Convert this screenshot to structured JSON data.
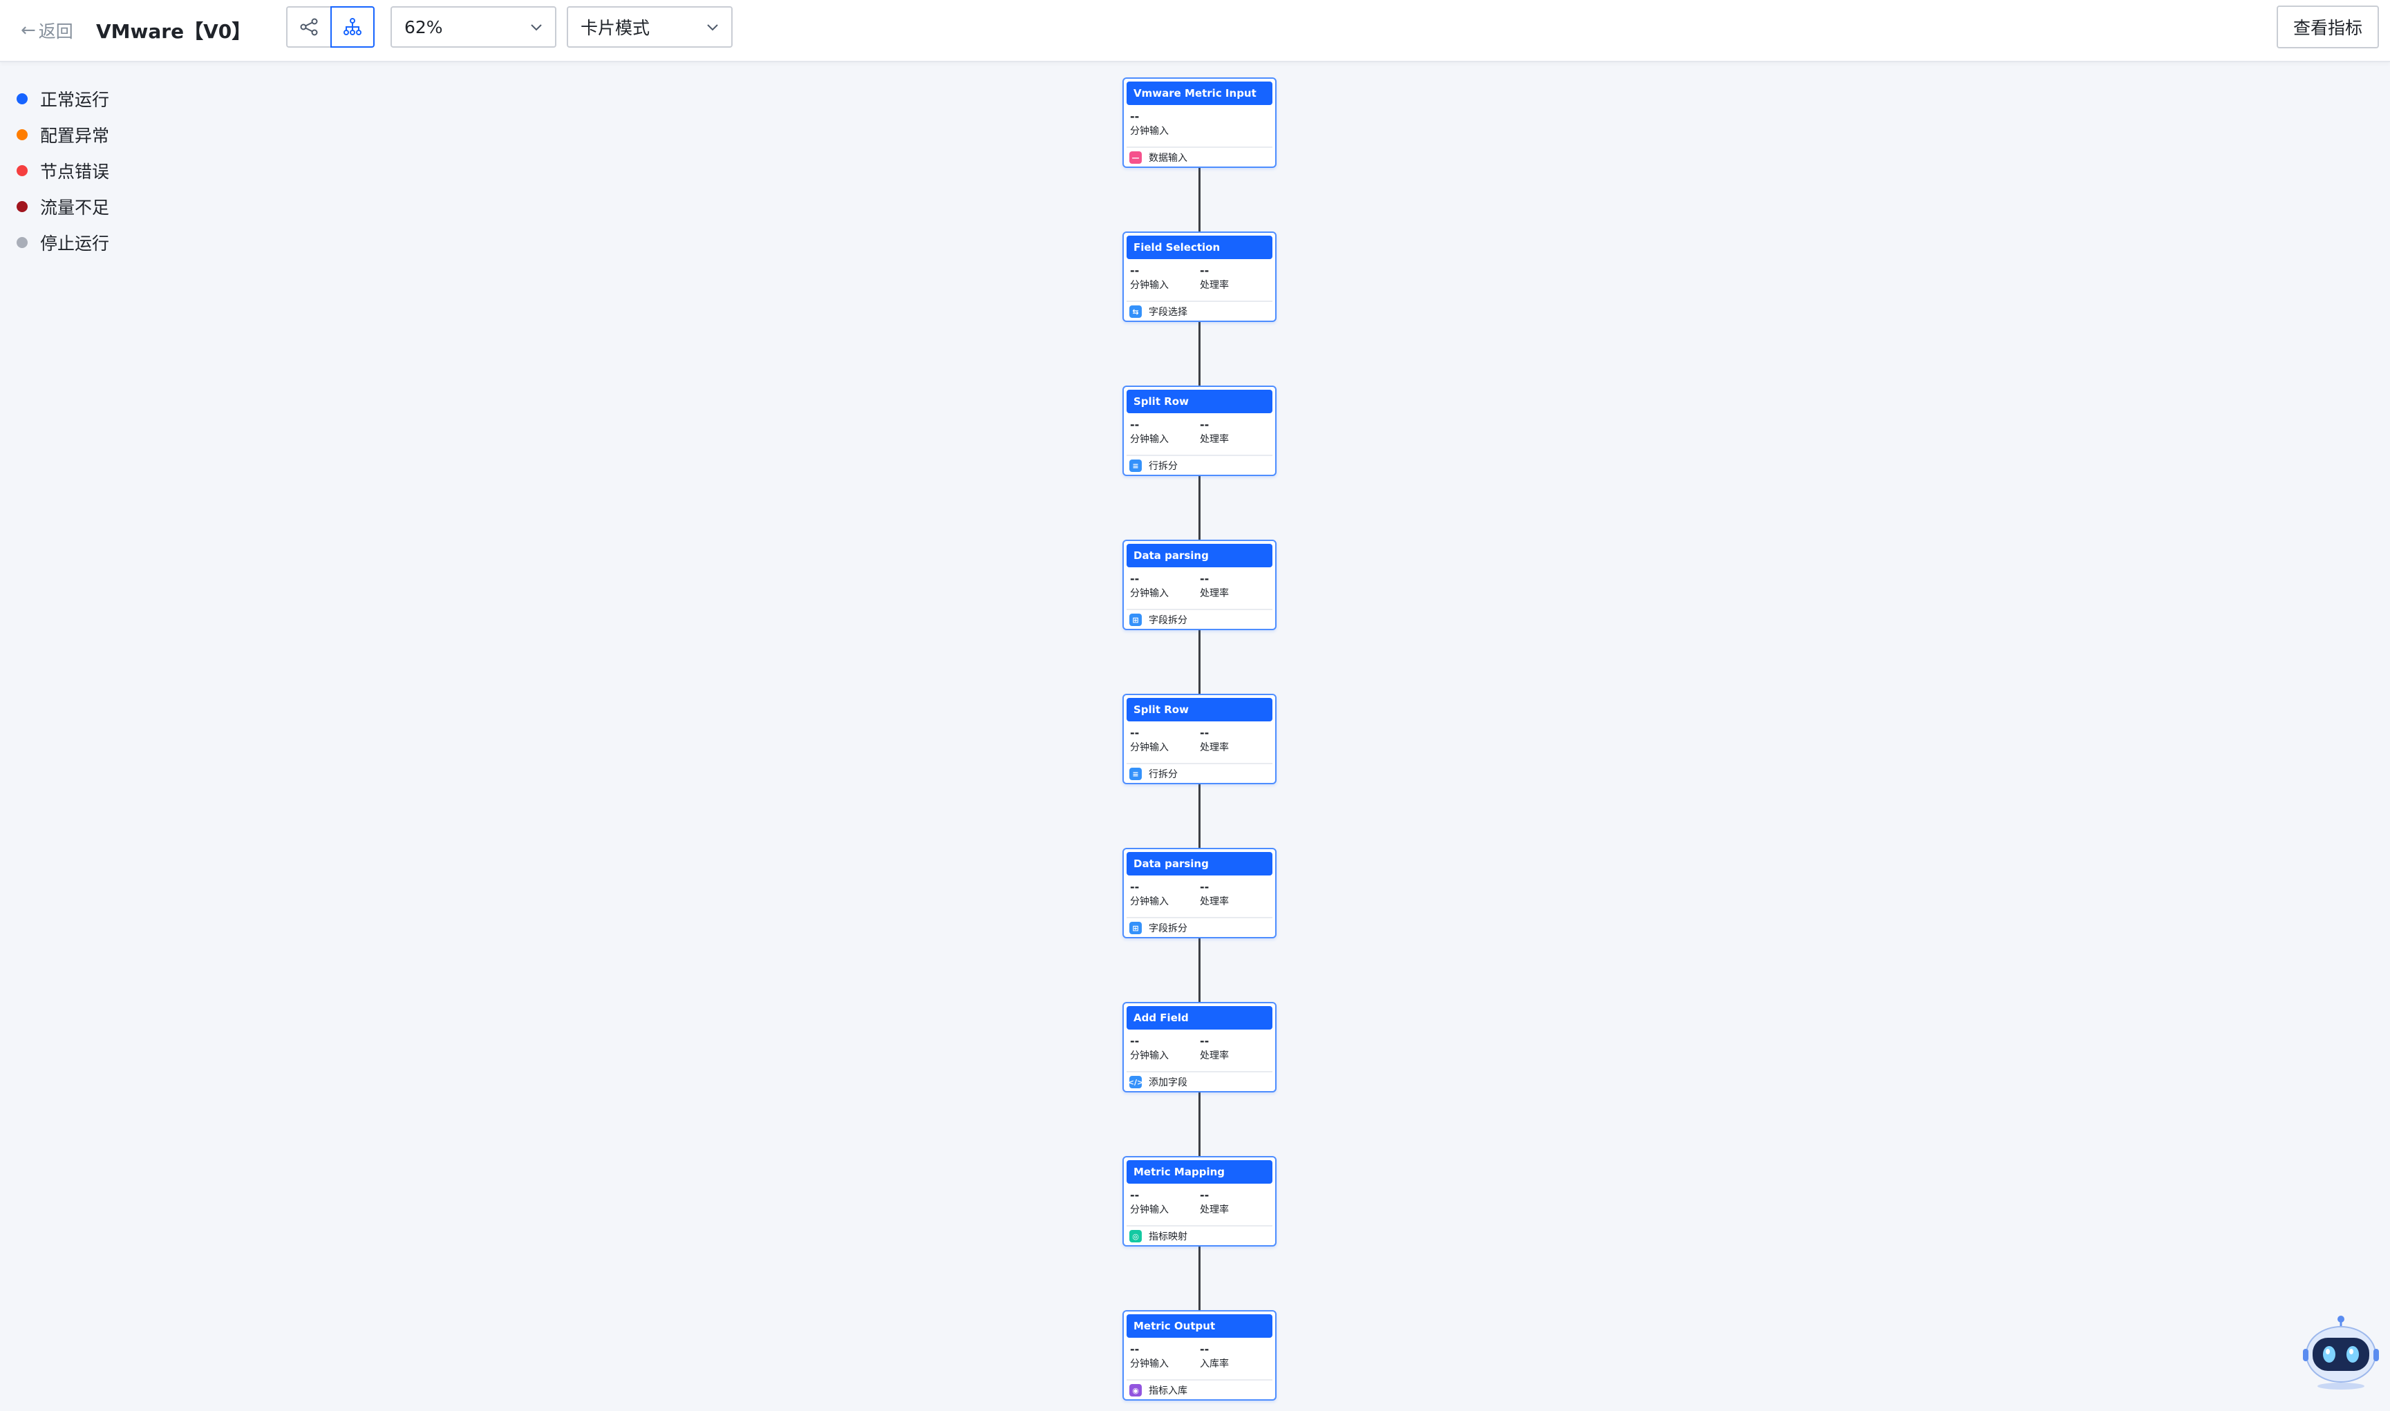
{
  "header": {
    "back_label": "返回",
    "title": "VMware【V0】",
    "zoom_value": "62%",
    "mode_value": "卡片模式",
    "metrics_button": "查看指标"
  },
  "legend": [
    {
      "label": "正常运行",
      "color": "#1664ff"
    },
    {
      "label": "配置异常",
      "color": "#ff7d00"
    },
    {
      "label": "节点错误",
      "color": "#f53f3f"
    },
    {
      "label": "流量不足",
      "color": "#a1151e"
    },
    {
      "label": "停止运行",
      "color": "#a9aeb8"
    }
  ],
  "pipeline": [
    {
      "title": "Vmware Metric Input",
      "stats": [
        {
          "value": "--",
          "label": "分钟输入"
        }
      ],
      "type_label": "数据输入",
      "icon": "data-input-icon",
      "icon_color": "#f5518c"
    },
    {
      "title": "Field Selection",
      "stats": [
        {
          "value": "--",
          "label": "分钟输入"
        },
        {
          "value": "--",
          "label": "处理率"
        }
      ],
      "type_label": "字段选择",
      "icon": "field-select-icon",
      "icon_color": "#3491fa"
    },
    {
      "title": "Split Row",
      "stats": [
        {
          "value": "--",
          "label": "分钟输入"
        },
        {
          "value": "--",
          "label": "处理率"
        }
      ],
      "type_label": "行拆分",
      "icon": "split-row-icon",
      "icon_color": "#3491fa"
    },
    {
      "title": "Data parsing",
      "stats": [
        {
          "value": "--",
          "label": "分钟输入"
        },
        {
          "value": "--",
          "label": "处理率"
        }
      ],
      "type_label": "字段拆分",
      "icon": "field-split-icon",
      "icon_color": "#3491fa"
    },
    {
      "title": "Split Row",
      "stats": [
        {
          "value": "--",
          "label": "分钟输入"
        },
        {
          "value": "--",
          "label": "处理率"
        }
      ],
      "type_label": "行拆分",
      "icon": "split-row-icon",
      "icon_color": "#3491fa"
    },
    {
      "title": "Data parsing",
      "stats": [
        {
          "value": "--",
          "label": "分钟输入"
        },
        {
          "value": "--",
          "label": "处理率"
        }
      ],
      "type_label": "字段拆分",
      "icon": "field-split-icon",
      "icon_color": "#3491fa"
    },
    {
      "title": "Add Field",
      "stats": [
        {
          "value": "--",
          "label": "分钟输入"
        },
        {
          "value": "--",
          "label": "处理率"
        }
      ],
      "type_label": "添加字段",
      "icon": "add-field-icon",
      "icon_color": "#3491fa"
    },
    {
      "title": "Metric Mapping",
      "stats": [
        {
          "value": "--",
          "label": "分钟输入"
        },
        {
          "value": "--",
          "label": "处理率"
        }
      ],
      "type_label": "指标映射",
      "icon": "metric-mapping-icon",
      "icon_color": "#14c9a2"
    },
    {
      "title": "Metric Output",
      "stats": [
        {
          "value": "--",
          "label": "分钟输入"
        },
        {
          "value": "--",
          "label": "入库率"
        }
      ],
      "type_label": "指标入库",
      "icon": "metric-output-icon",
      "icon_color": "#9254de"
    }
  ],
  "assistant": {
    "icon": "robot-assistant-icon"
  }
}
